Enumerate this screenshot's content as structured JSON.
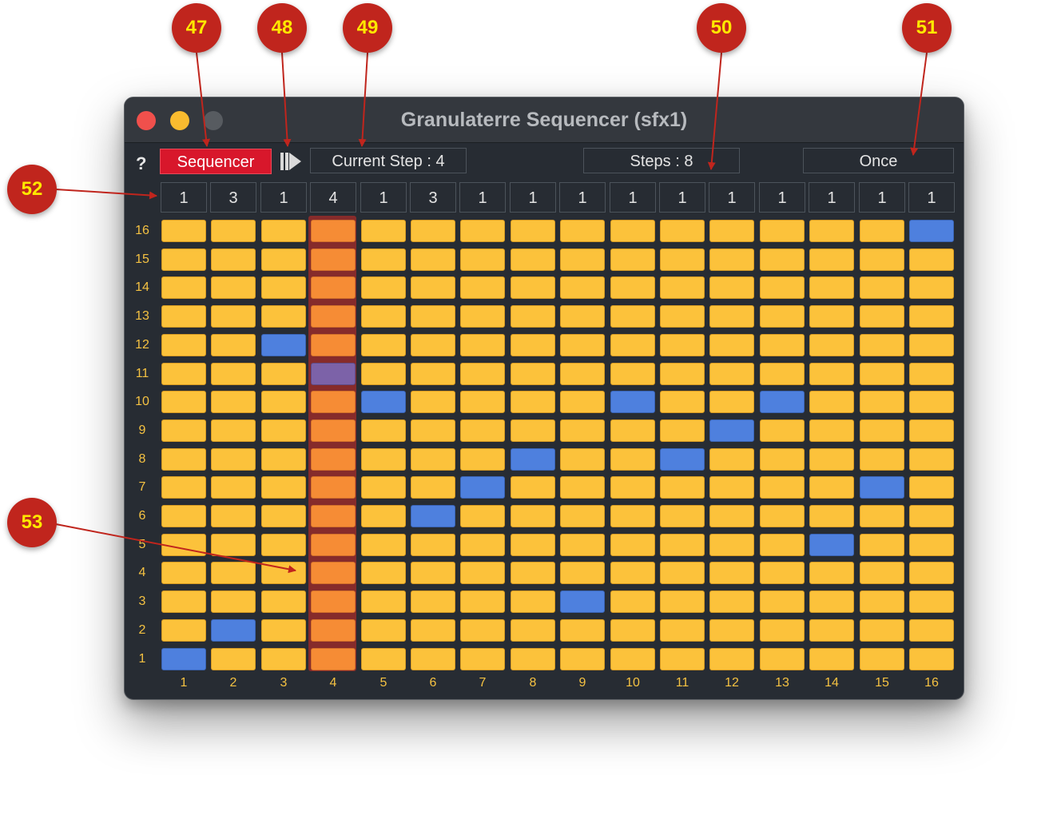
{
  "window": {
    "title": "Granulaterre Sequencer (sfx1)"
  },
  "toolbar": {
    "help_label": "?",
    "sequencer_label": "Sequencer",
    "current_step_label": "Current Step : 4",
    "steps_label": "Steps : 8",
    "mode_label": "Once"
  },
  "step_values": [
    "1",
    "3",
    "1",
    "4",
    "1",
    "3",
    "1",
    "1",
    "1",
    "1",
    "1",
    "1",
    "1",
    "1",
    "1",
    "1"
  ],
  "row_labels": [
    "16",
    "15",
    "14",
    "13",
    "12",
    "11",
    "10",
    "9",
    "8",
    "7",
    "6",
    "5",
    "4",
    "3",
    "2",
    "1"
  ],
  "column_labels": [
    "1",
    "2",
    "3",
    "4",
    "5",
    "6",
    "7",
    "8",
    "9",
    "10",
    "11",
    "12",
    "13",
    "14",
    "15",
    "16"
  ],
  "current_step": 4,
  "active_rows_by_column": [
    1,
    2,
    12,
    11,
    10,
    6,
    7,
    8,
    3,
    10,
    8,
    9,
    10,
    5,
    7,
    16
  ],
  "colors": {
    "cell": "#fcc23b",
    "active_cell": "#4e80de",
    "current_step_cell": "#f68c35",
    "current_step_active_cell": "#7c62a8",
    "sequencer_button": "#d8172b",
    "callout": "#c0251d",
    "callout_text": "#ffe800"
  },
  "callouts": [
    "47",
    "48",
    "49",
    "50",
    "51",
    "52",
    "53"
  ]
}
